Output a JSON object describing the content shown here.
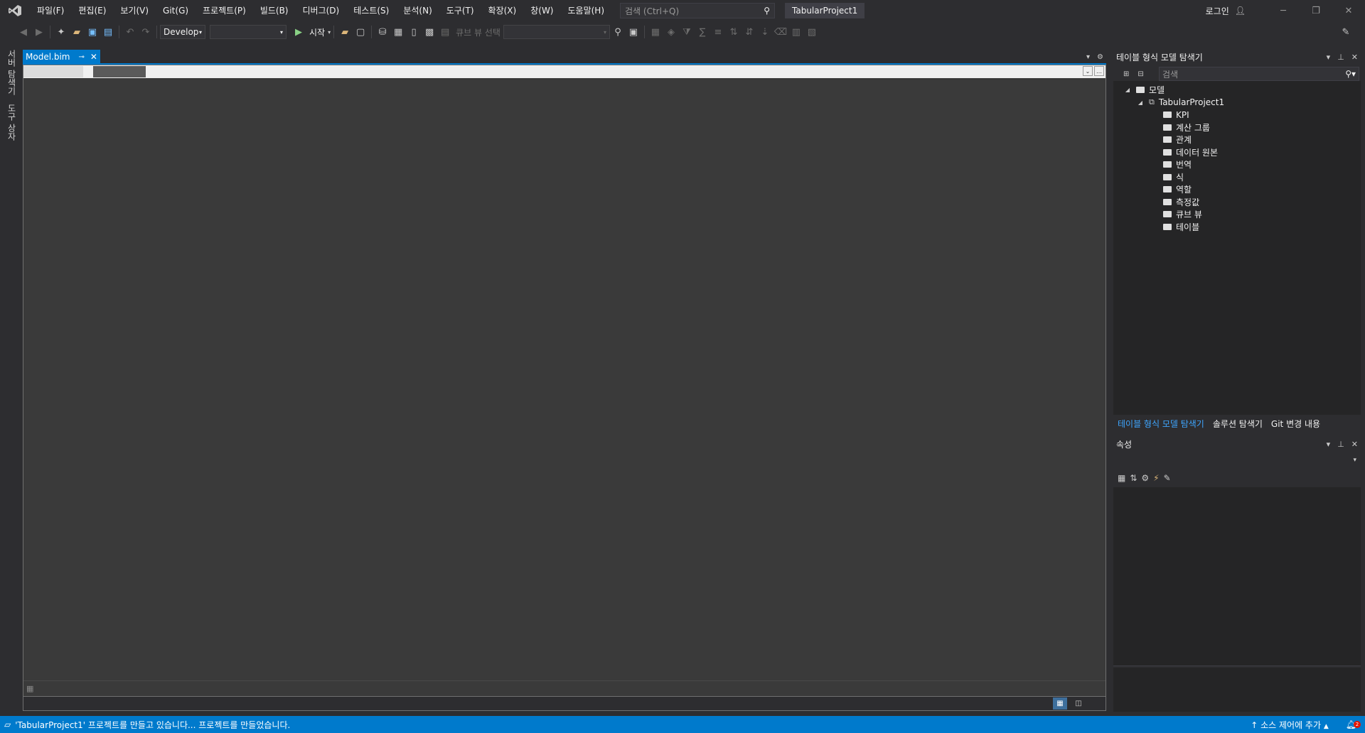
{
  "menu": [
    "파일(F)",
    "편집(E)",
    "보기(V)",
    "Git(G)",
    "프로젝트(P)",
    "빌드(B)",
    "디버그(D)",
    "테스트(S)",
    "분석(N)",
    "도구(T)",
    "확장(X)",
    "창(W)",
    "도움말(H)"
  ],
  "search": {
    "placeholder": "검색 (Ctrl+Q)"
  },
  "window": {
    "project_title": "TabularProject1",
    "login": "로그인"
  },
  "toolbar": {
    "config": "Develop",
    "platform": "",
    "start": "시작",
    "cube_view_label": "큐브 뷰 선택"
  },
  "left_strip": {
    "server_explorer": "서버 탐색기",
    "toolbox": "도구 상자"
  },
  "document": {
    "tab_title": "Model.bim"
  },
  "tabular_explorer": {
    "title": "테이블 형식 모델 탐색기",
    "search_placeholder": "검색",
    "root": "모델",
    "project": "TabularProject1",
    "items": [
      "KPI",
      "계산 그룹",
      "관계",
      "데이터 원본",
      "번역",
      "식",
      "역할",
      "측정값",
      "큐브 뷰",
      "테이블"
    ]
  },
  "panel_tabs": [
    "테이블 형식 모델 탐색기",
    "솔루션 탐색기",
    "Git 변경 내용"
  ],
  "properties": {
    "title": "속성"
  },
  "status": {
    "message": "'TabularProject1' 프로젝트를 만들고 있습니다... 프로젝트를 만들었습니다.",
    "source_control": "소스 제어에 추가",
    "notifications": "2"
  },
  "colors": {
    "accent": "#007acc",
    "background": "#2d2d30",
    "panel": "#252526",
    "active_tab_text": "#3ea6ff"
  }
}
